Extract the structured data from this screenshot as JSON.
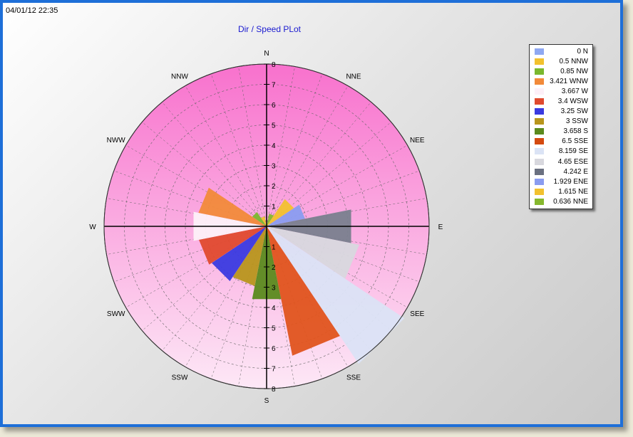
{
  "timestamp": "04/01/12 22:35",
  "chart_data": {
    "type": "polar-area",
    "title": "Dir / Speed PLot",
    "r_range": [
      0,
      8
    ],
    "radial_ticks": [
      "1",
      "2",
      "3",
      "4",
      "5",
      "6",
      "7",
      "8"
    ],
    "directions": [
      "N",
      "NNE",
      "NEE",
      "E",
      "SEE",
      "SSE",
      "S",
      "SSW",
      "SWW",
      "W",
      "NWW",
      "NNW"
    ],
    "background_colors": {
      "outer": "#f871cd",
      "inner": "#fde8f6"
    },
    "sectors": [
      {
        "label": "0 N",
        "dir": "N",
        "angle": 0,
        "value": 0,
        "color": "#8fa8f2"
      },
      {
        "label": "0.636 NNE",
        "dir": "NNE",
        "angle": 22.5,
        "value": 0.636,
        "color": "#86b82e"
      },
      {
        "label": "1.615 NE",
        "dir": "NE",
        "angle": 45,
        "value": 1.615,
        "color": "#f2c12e"
      },
      {
        "label": "1.929 ENE",
        "dir": "ENE",
        "angle": 67.5,
        "value": 1.929,
        "color": "#8a9cf0"
      },
      {
        "label": "4.242 E",
        "dir": "E",
        "angle": 90,
        "value": 4.242,
        "color": "#7a7f8e"
      },
      {
        "label": "4.65 ESE",
        "dir": "ESE",
        "angle": 112.5,
        "value": 4.65,
        "color": "#d8d8de"
      },
      {
        "label": "8.159 SE",
        "dir": "SE",
        "angle": 135,
        "value": 8.159,
        "color": "#dbe3f5"
      },
      {
        "label": "6.5 SSE",
        "dir": "SSE",
        "angle": 157.5,
        "value": 6.5,
        "color": "#e0541e"
      },
      {
        "label": "3.658 S",
        "dir": "S",
        "angle": 180,
        "value": 3.658,
        "color": "#5b8a1e"
      },
      {
        "label": "3 SSW",
        "dir": "SSW",
        "angle": 202.5,
        "value": 3,
        "color": "#b8951c"
      },
      {
        "label": "3.25 SW",
        "dir": "SW",
        "angle": 225,
        "value": 3.25,
        "color": "#3a3ae0"
      },
      {
        "label": "3.4 WSW",
        "dir": "WSW",
        "angle": 247.5,
        "value": 3.4,
        "color": "#e04a2e"
      },
      {
        "label": "3.667 W",
        "dir": "W",
        "angle": 270,
        "value": 3.667,
        "color": "#fdf0f8"
      },
      {
        "label": "3.421 WNW",
        "dir": "WNW",
        "angle": 292.5,
        "value": 3.421,
        "color": "#f28a3a"
      },
      {
        "label": "0.85 NW",
        "dir": "NW",
        "angle": 315,
        "value": 0.85,
        "color": "#7ab82e"
      },
      {
        "label": "0.5 NNW",
        "dir": "NNW",
        "angle": 337.5,
        "value": 0.5,
        "color": "#f2c12e"
      }
    ],
    "legend": [
      {
        "label": "0 N",
        "color": "#8fa8f2"
      },
      {
        "label": "0.5 NNW",
        "color": "#f2c12e"
      },
      {
        "label": "0.85 NW",
        "color": "#7ab82e"
      },
      {
        "label": "3.421 WNW",
        "color": "#f28a3a"
      },
      {
        "label": "3.667 W",
        "color": "#fdf0f8"
      },
      {
        "label": "3.4 WSW",
        "color": "#e04a2e"
      },
      {
        "label": "3.25 SW",
        "color": "#3a3ae0"
      },
      {
        "label": "3 SSW",
        "color": "#b8951c"
      },
      {
        "label": "3.658 S",
        "color": "#5b8a1e"
      },
      {
        "label": "6.5 SSE",
        "color": "#d44a10"
      },
      {
        "label": "8.159 SE",
        "color": "#dbe3f5"
      },
      {
        "label": "4.65 ESE",
        "color": "#d8d8de"
      },
      {
        "label": "4.242 E",
        "color": "#6a7080"
      },
      {
        "label": "1.929 ENE",
        "color": "#8a9cf0"
      },
      {
        "label": "1.615 NE",
        "color": "#f2c12e"
      },
      {
        "label": "0.636 NNE",
        "color": "#86b82e"
      }
    ],
    "legend_position": "top-right"
  }
}
